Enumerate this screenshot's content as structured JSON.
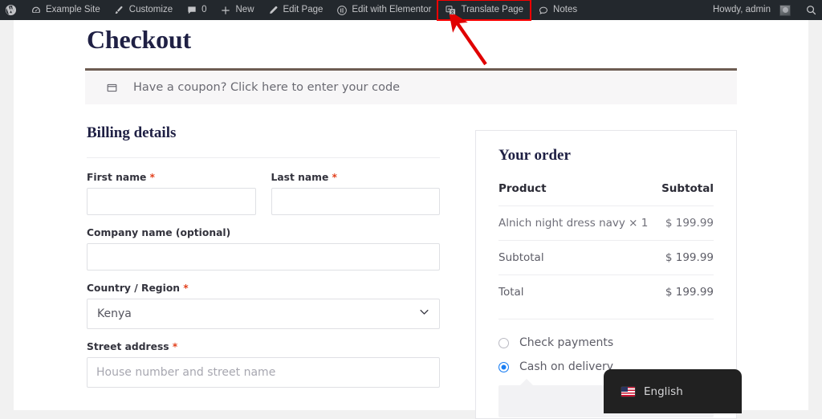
{
  "adminbar": {
    "left_items": [
      {
        "id": "wp-logo",
        "icon": "wordpress-icon",
        "label": ""
      },
      {
        "id": "site-name",
        "icon": "dashboard-icon",
        "label": "Example Site"
      },
      {
        "id": "customize",
        "icon": "paintbrush-icon",
        "label": "Customize"
      },
      {
        "id": "comments",
        "icon": "comment-bubble-icon",
        "label": "0"
      },
      {
        "id": "new-content",
        "icon": "plus-icon",
        "label": "New"
      },
      {
        "id": "edit-page",
        "icon": "pencil-icon",
        "label": "Edit Page"
      },
      {
        "id": "edit-with-elementor",
        "icon": "elementor-icon",
        "label": "Edit with Elementor"
      },
      {
        "id": "translate-page",
        "icon": "translate-icon",
        "label": "Translate Page"
      },
      {
        "id": "notes",
        "icon": "note-bubble-icon",
        "label": "Notes"
      }
    ],
    "howdy": "Howdy, admin",
    "search_icon": "search-icon",
    "avatar": "avatar",
    "highlight_color": "#f60000",
    "bar_color": "#23282d"
  },
  "page": {
    "title": "Checkout",
    "coupon_notice": "Have a coupon? Click here to enter your code",
    "coupon_icon": "coupon-tag-icon",
    "coupon_border_color": "#6d5c52"
  },
  "billing": {
    "heading": "Billing details",
    "required_mark": "*",
    "fields": {
      "first_name": {
        "label": "First name",
        "required": true,
        "value": "",
        "placeholder": ""
      },
      "last_name": {
        "label": "Last name",
        "required": true,
        "value": "",
        "placeholder": ""
      },
      "company": {
        "label": "Company name (optional)",
        "required": false,
        "value": "",
        "placeholder": ""
      },
      "country": {
        "label": "Country / Region",
        "required": true,
        "value": "Kenya",
        "chevron": "chevron-down-icon"
      },
      "street": {
        "label": "Street address",
        "required": true,
        "value": "",
        "placeholder": "House number and street name"
      }
    }
  },
  "order": {
    "heading": "Your order",
    "columns": [
      "Product",
      "Subtotal"
    ],
    "rows": [
      {
        "label": "Alnich night dress navy × 1",
        "amount": "$ 199.99"
      },
      {
        "label": "Subtotal",
        "amount": "$ 199.99"
      },
      {
        "label": "Total",
        "amount": "$ 199.99"
      }
    ],
    "payment_methods": [
      {
        "label": "Check payments",
        "selected": false
      },
      {
        "label": "Cash on delivery",
        "selected": true
      }
    ],
    "accent_color": "#1a7ef2"
  },
  "language_widget": {
    "label": "English",
    "flag": "us-flag-icon",
    "background": "#212121"
  }
}
